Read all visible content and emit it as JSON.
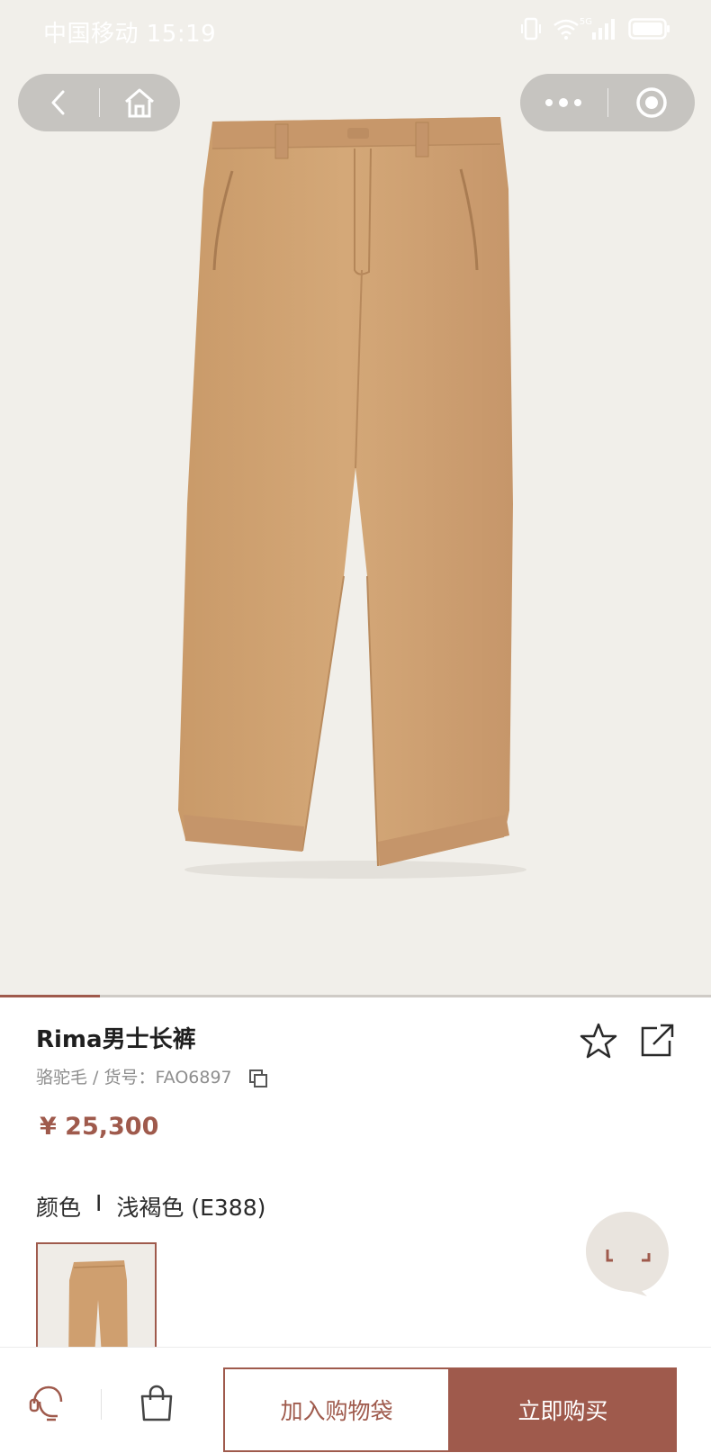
{
  "status_bar": {
    "carrier_time": "中国移动 15:19",
    "network_label": "5G",
    "icons": [
      "vibrate-icon",
      "wifi-icon",
      "signal-icon",
      "battery-icon"
    ]
  },
  "nav_capsule": {
    "icons": [
      "chevron-left-icon",
      "home-icon"
    ]
  },
  "menu_capsule": {
    "icons": [
      "more-dots-icon",
      "close-target-icon"
    ]
  },
  "gallery": {
    "image": "camel-trousers",
    "progress": 0.14
  },
  "product": {
    "title": "Rima男士长裤",
    "meta": "骆驼毛 / 货号：FAO6897",
    "price": "¥ 25,300",
    "actions": [
      "star-icon",
      "share-icon"
    ]
  },
  "color": {
    "label": "颜色",
    "separator": "I",
    "value": "浅褐色 (E388)"
  },
  "chat": {
    "icon": "chat-bubble-icon"
  },
  "bottom_bar": {
    "add_to_bag": "加入购物袋",
    "buy_now": "立即购买",
    "icons": [
      "customer-service-icon",
      "shopping-bag-icon"
    ]
  },
  "colors": {
    "accent": "#9f5a4c",
    "fabric": "#d1a577",
    "hero_bg": "#f1efea"
  }
}
